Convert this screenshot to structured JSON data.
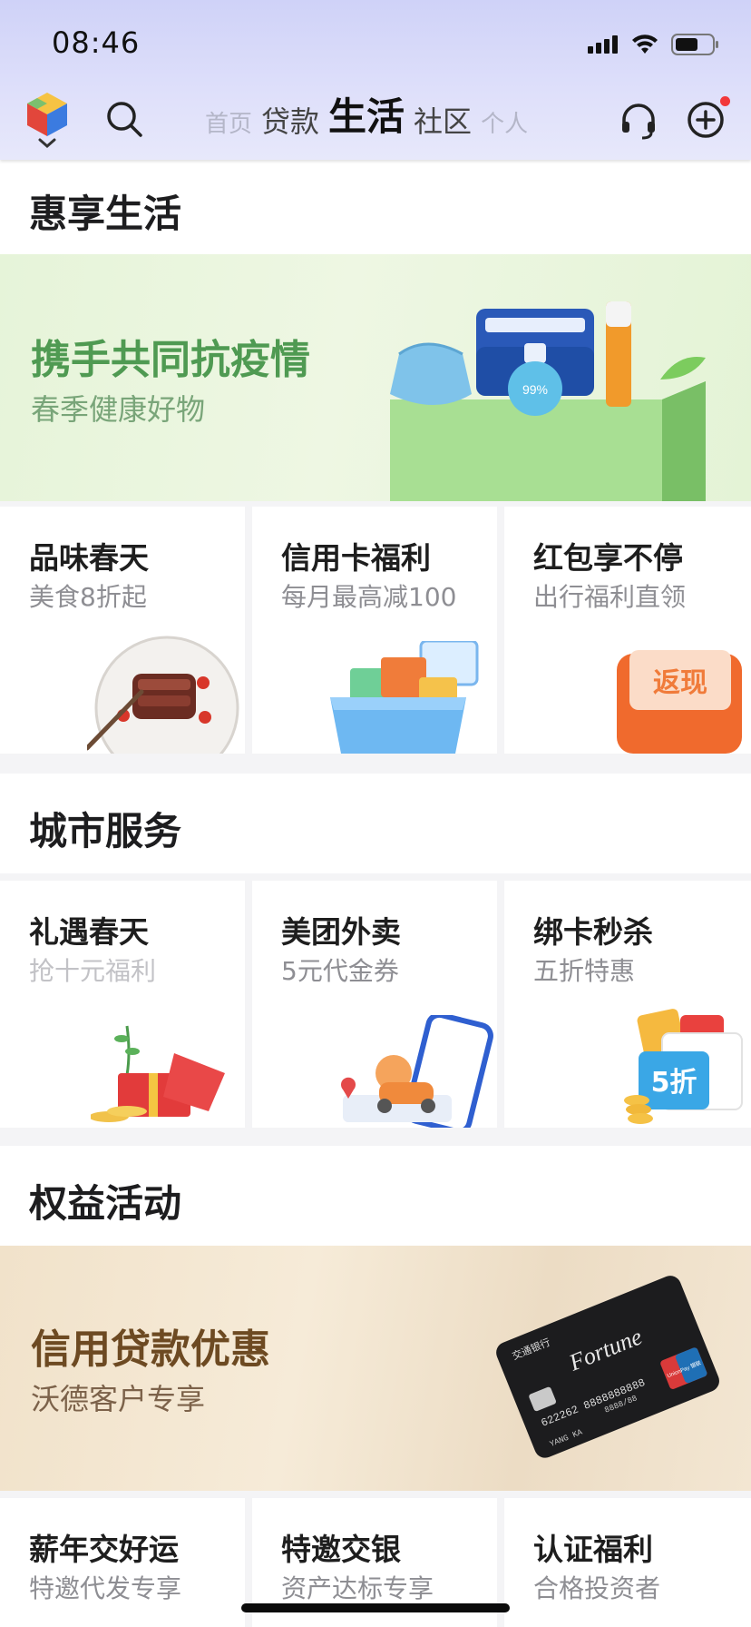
{
  "status": {
    "time": "08:46"
  },
  "nav": {
    "tabs": [
      {
        "label": "首页"
      },
      {
        "label": "贷款"
      },
      {
        "label": "生活"
      },
      {
        "label": "社区"
      },
      {
        "label": "个人"
      }
    ],
    "active_tab": "生活"
  },
  "sections": {
    "life": {
      "title": "惠享生活",
      "banner": {
        "title": "携手共同抗疫情",
        "subtitle": "春季健康好物",
        "product_text": "99%"
      },
      "cards": [
        {
          "title": "品味春天",
          "subtitle": "美食8折起"
        },
        {
          "title": "信用卡福利",
          "subtitle": "每月最高减100"
        },
        {
          "title": "红包享不停",
          "subtitle": "出行福利直领",
          "art_text": "返现"
        }
      ]
    },
    "city": {
      "title": "城市服务",
      "cards": [
        {
          "title": "礼遇春天",
          "subtitle": "抢十元福利"
        },
        {
          "title": "美团外卖",
          "subtitle": "5元代金券"
        },
        {
          "title": "绑卡秒杀",
          "subtitle": "五折特惠",
          "art_text": "5折"
        }
      ]
    },
    "rights": {
      "title": "权益活动",
      "banner": {
        "title": "信用贷款优惠",
        "subtitle": "沃德客户专享",
        "card_brand": "Fortune",
        "card_number": "622262 8888888888",
        "card_expiry": "8888/88",
        "card_holder": "YANG KA",
        "card_bank": "交通银行",
        "card_network": "UnionPay 银联"
      },
      "cards": [
        {
          "title": "薪年交好运",
          "subtitle": "特邀代发专享"
        },
        {
          "title": "特邀交银",
          "subtitle": "资产达标专享"
        },
        {
          "title": "认证福利",
          "subtitle": "合格投资者"
        }
      ]
    }
  },
  "colors": {
    "header": "#dfe0fa",
    "life_banner_title": "#4f9a52",
    "life_banner_sub": "#79a579",
    "rights_banner_title": "#6d4a22",
    "rights_banner_sub": "#7c624a"
  }
}
